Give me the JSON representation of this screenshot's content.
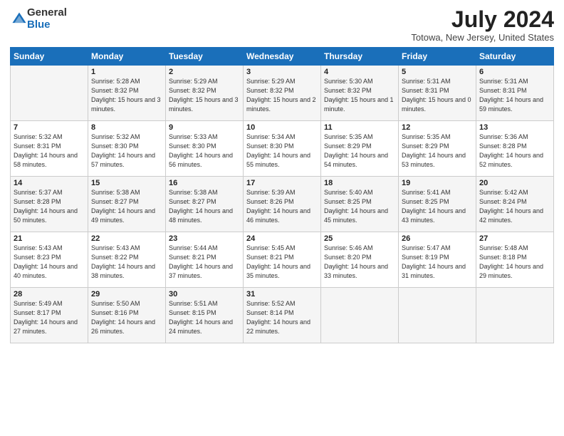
{
  "logo": {
    "general": "General",
    "blue": "Blue"
  },
  "title": "July 2024",
  "subtitle": "Totowa, New Jersey, United States",
  "days_header": [
    "Sunday",
    "Monday",
    "Tuesday",
    "Wednesday",
    "Thursday",
    "Friday",
    "Saturday"
  ],
  "weeks": [
    [
      {
        "num": "",
        "rise": "",
        "set": "",
        "daylight": ""
      },
      {
        "num": "1",
        "rise": "Sunrise: 5:28 AM",
        "set": "Sunset: 8:32 PM",
        "daylight": "Daylight: 15 hours and 3 minutes."
      },
      {
        "num": "2",
        "rise": "Sunrise: 5:29 AM",
        "set": "Sunset: 8:32 PM",
        "daylight": "Daylight: 15 hours and 3 minutes."
      },
      {
        "num": "3",
        "rise": "Sunrise: 5:29 AM",
        "set": "Sunset: 8:32 PM",
        "daylight": "Daylight: 15 hours and 2 minutes."
      },
      {
        "num": "4",
        "rise": "Sunrise: 5:30 AM",
        "set": "Sunset: 8:32 PM",
        "daylight": "Daylight: 15 hours and 1 minute."
      },
      {
        "num": "5",
        "rise": "Sunrise: 5:31 AM",
        "set": "Sunset: 8:31 PM",
        "daylight": "Daylight: 15 hours and 0 minutes."
      },
      {
        "num": "6",
        "rise": "Sunrise: 5:31 AM",
        "set": "Sunset: 8:31 PM",
        "daylight": "Daylight: 14 hours and 59 minutes."
      }
    ],
    [
      {
        "num": "7",
        "rise": "Sunrise: 5:32 AM",
        "set": "Sunset: 8:31 PM",
        "daylight": "Daylight: 14 hours and 58 minutes."
      },
      {
        "num": "8",
        "rise": "Sunrise: 5:32 AM",
        "set": "Sunset: 8:30 PM",
        "daylight": "Daylight: 14 hours and 57 minutes."
      },
      {
        "num": "9",
        "rise": "Sunrise: 5:33 AM",
        "set": "Sunset: 8:30 PM",
        "daylight": "Daylight: 14 hours and 56 minutes."
      },
      {
        "num": "10",
        "rise": "Sunrise: 5:34 AM",
        "set": "Sunset: 8:30 PM",
        "daylight": "Daylight: 14 hours and 55 minutes."
      },
      {
        "num": "11",
        "rise": "Sunrise: 5:35 AM",
        "set": "Sunset: 8:29 PM",
        "daylight": "Daylight: 14 hours and 54 minutes."
      },
      {
        "num": "12",
        "rise": "Sunrise: 5:35 AM",
        "set": "Sunset: 8:29 PM",
        "daylight": "Daylight: 14 hours and 53 minutes."
      },
      {
        "num": "13",
        "rise": "Sunrise: 5:36 AM",
        "set": "Sunset: 8:28 PM",
        "daylight": "Daylight: 14 hours and 52 minutes."
      }
    ],
    [
      {
        "num": "14",
        "rise": "Sunrise: 5:37 AM",
        "set": "Sunset: 8:28 PM",
        "daylight": "Daylight: 14 hours and 50 minutes."
      },
      {
        "num": "15",
        "rise": "Sunrise: 5:38 AM",
        "set": "Sunset: 8:27 PM",
        "daylight": "Daylight: 14 hours and 49 minutes."
      },
      {
        "num": "16",
        "rise": "Sunrise: 5:38 AM",
        "set": "Sunset: 8:27 PM",
        "daylight": "Daylight: 14 hours and 48 minutes."
      },
      {
        "num": "17",
        "rise": "Sunrise: 5:39 AM",
        "set": "Sunset: 8:26 PM",
        "daylight": "Daylight: 14 hours and 46 minutes."
      },
      {
        "num": "18",
        "rise": "Sunrise: 5:40 AM",
        "set": "Sunset: 8:25 PM",
        "daylight": "Daylight: 14 hours and 45 minutes."
      },
      {
        "num": "19",
        "rise": "Sunrise: 5:41 AM",
        "set": "Sunset: 8:25 PM",
        "daylight": "Daylight: 14 hours and 43 minutes."
      },
      {
        "num": "20",
        "rise": "Sunrise: 5:42 AM",
        "set": "Sunset: 8:24 PM",
        "daylight": "Daylight: 14 hours and 42 minutes."
      }
    ],
    [
      {
        "num": "21",
        "rise": "Sunrise: 5:43 AM",
        "set": "Sunset: 8:23 PM",
        "daylight": "Daylight: 14 hours and 40 minutes."
      },
      {
        "num": "22",
        "rise": "Sunrise: 5:43 AM",
        "set": "Sunset: 8:22 PM",
        "daylight": "Daylight: 14 hours and 38 minutes."
      },
      {
        "num": "23",
        "rise": "Sunrise: 5:44 AM",
        "set": "Sunset: 8:21 PM",
        "daylight": "Daylight: 14 hours and 37 minutes."
      },
      {
        "num": "24",
        "rise": "Sunrise: 5:45 AM",
        "set": "Sunset: 8:21 PM",
        "daylight": "Daylight: 14 hours and 35 minutes."
      },
      {
        "num": "25",
        "rise": "Sunrise: 5:46 AM",
        "set": "Sunset: 8:20 PM",
        "daylight": "Daylight: 14 hours and 33 minutes."
      },
      {
        "num": "26",
        "rise": "Sunrise: 5:47 AM",
        "set": "Sunset: 8:19 PM",
        "daylight": "Daylight: 14 hours and 31 minutes."
      },
      {
        "num": "27",
        "rise": "Sunrise: 5:48 AM",
        "set": "Sunset: 8:18 PM",
        "daylight": "Daylight: 14 hours and 29 minutes."
      }
    ],
    [
      {
        "num": "28",
        "rise": "Sunrise: 5:49 AM",
        "set": "Sunset: 8:17 PM",
        "daylight": "Daylight: 14 hours and 27 minutes."
      },
      {
        "num": "29",
        "rise": "Sunrise: 5:50 AM",
        "set": "Sunset: 8:16 PM",
        "daylight": "Daylight: 14 hours and 26 minutes."
      },
      {
        "num": "30",
        "rise": "Sunrise: 5:51 AM",
        "set": "Sunset: 8:15 PM",
        "daylight": "Daylight: 14 hours and 24 minutes."
      },
      {
        "num": "31",
        "rise": "Sunrise: 5:52 AM",
        "set": "Sunset: 8:14 PM",
        "daylight": "Daylight: 14 hours and 22 minutes."
      },
      {
        "num": "",
        "rise": "",
        "set": "",
        "daylight": ""
      },
      {
        "num": "",
        "rise": "",
        "set": "",
        "daylight": ""
      },
      {
        "num": "",
        "rise": "",
        "set": "",
        "daylight": ""
      }
    ]
  ]
}
